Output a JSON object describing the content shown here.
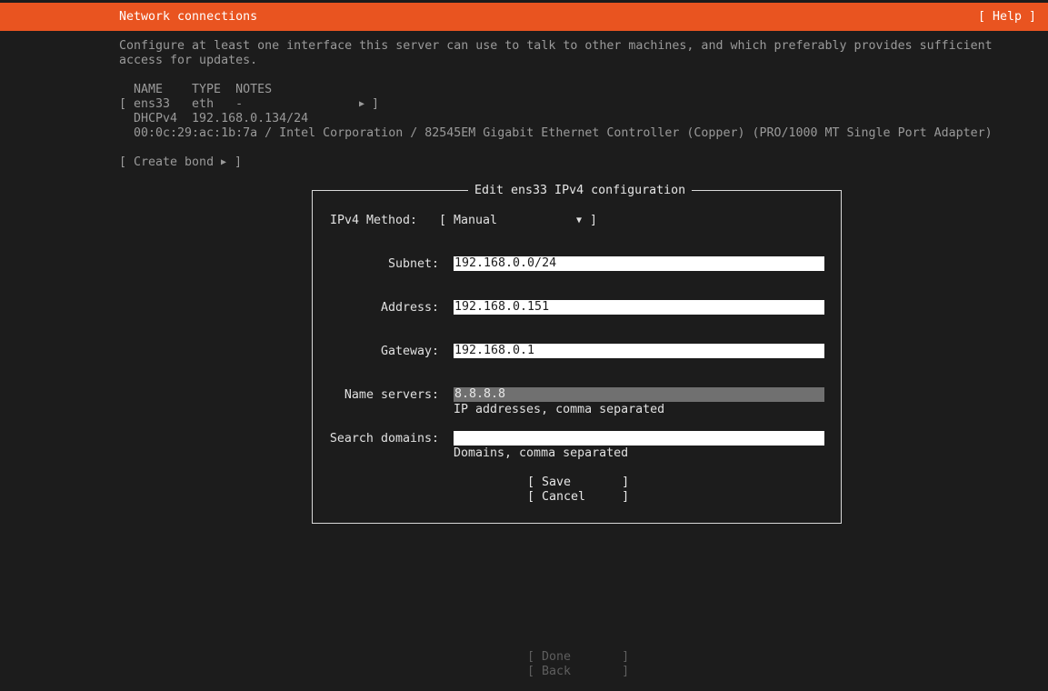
{
  "header": {
    "title": "Network connections",
    "help_label": "[ Help ]"
  },
  "intro": {
    "line1": "Configure at least one interface this server can use to talk to other machines, and which preferably provides sufficient",
    "line2": "access for updates."
  },
  "interfaces": {
    "headers": "NAME    TYPE  NOTES",
    "row_open": "[ ens33   eth   -",
    "row_close": "]",
    "dhcp_line": "DHCPv4  192.168.0.134/24",
    "hw_line": "00:0c:29:ac:1b:7a / Intel Corporation / 82545EM Gigabit Ethernet Controller (Copper) (PRO/1000 MT Single Port Adapter)"
  },
  "create_bond": {
    "open": "[ Create bond",
    "close": "]"
  },
  "dialog": {
    "title": "Edit ens33 IPv4 configuration",
    "method_label": "IPv4 Method:",
    "method_open": "[ Manual",
    "method_close": "]",
    "subnet_label": "Subnet:",
    "subnet_value": "192.168.0.0/24",
    "address_label": "Address:",
    "address_value": "192.168.0.151",
    "gateway_label": "Gateway:",
    "gateway_value": "192.168.0.1",
    "nameservers_label": "Name servers:",
    "nameservers_value": "8.8.8.8",
    "nameservers_hint": "IP addresses, comma separated",
    "searchdomains_label": "Search domains:",
    "searchdomains_value": "",
    "searchdomains_hint": "Domains, comma separated",
    "save_label": "[ Save       ]",
    "cancel_label": "[ Cancel     ]"
  },
  "footer": {
    "done_label": "[ Done       ]",
    "back_label": "[ Back       ]"
  },
  "icons": {
    "submenu": "right-triangle-icon",
    "dropdown": "down-triangle-icon"
  },
  "colors": {
    "accent": "#e95420",
    "background": "#1c1c1c"
  }
}
